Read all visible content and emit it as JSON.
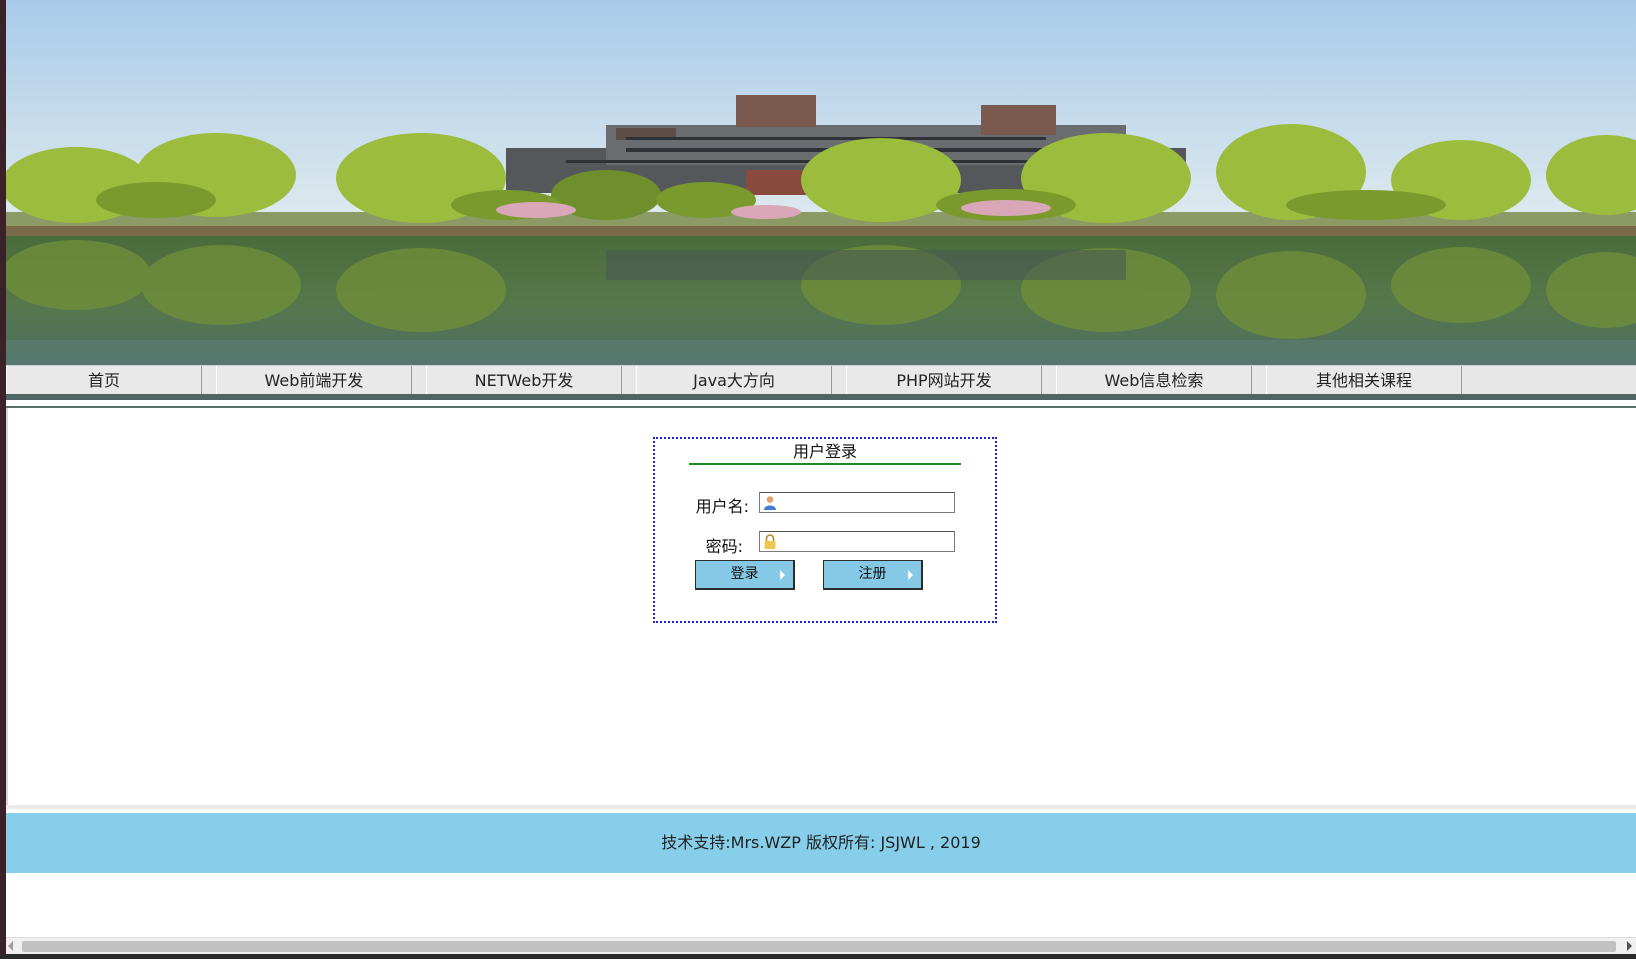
{
  "banner": {
    "image_description": "campus-building-lake-banner"
  },
  "nav": {
    "items": [
      {
        "label": "首页"
      },
      {
        "label": "Web前端开发"
      },
      {
        "label": "NETWeb开发"
      },
      {
        "label": "Java大方向"
      },
      {
        "label": "PHP网站开发"
      },
      {
        "label": "Web信息检索"
      },
      {
        "label": "其他相关课程"
      }
    ]
  },
  "login": {
    "title": "用户登录",
    "username_label": "用户名:",
    "username_value": "",
    "username_icon": "user-icon",
    "password_label": "密码:",
    "password_value": "",
    "password_icon": "lock-icon",
    "login_button": "登录",
    "register_button": "注册"
  },
  "footer": {
    "text": "技术支持:Mrs.WZP 版权所有: JSJWL , 2019"
  },
  "colors": {
    "nav_bg": "#e9e9e9",
    "login_border": "#1a22d8",
    "title_underline": "#1f8a1f",
    "button_bg": "#85c9e6",
    "footer_bg": "#87ceeb"
  }
}
